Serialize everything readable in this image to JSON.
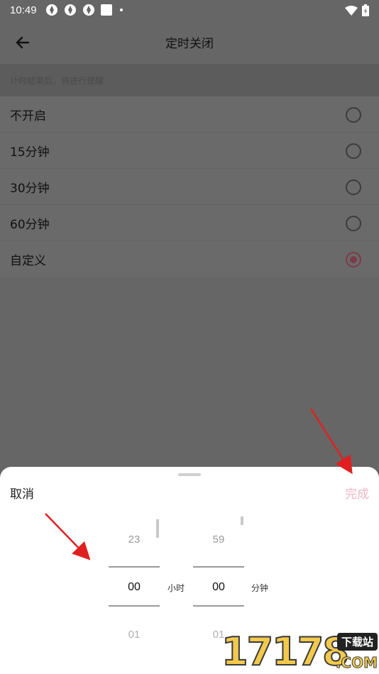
{
  "status_bar": {
    "time": "10:49"
  },
  "app_bar": {
    "title": "定时关闭"
  },
  "hint": "计时结束后，将进行提醒",
  "options": [
    {
      "label": "不开启",
      "selected": false
    },
    {
      "label": "15分钟",
      "selected": false
    },
    {
      "label": "30分钟",
      "selected": false
    },
    {
      "label": "60分钟",
      "selected": false
    },
    {
      "label": "自定义",
      "selected": true
    }
  ],
  "sheet": {
    "cancel_label": "取消",
    "done_label": "完成",
    "hours": {
      "prev": "23",
      "current": "00",
      "next": "01",
      "unit": "小时"
    },
    "minutes": {
      "prev": "59",
      "current": "00",
      "next": "01",
      "unit": "分钟"
    }
  },
  "colors": {
    "accent": "#7d3b4c",
    "done_disabled": "#f3b6c5",
    "arrow": "#e02020"
  },
  "watermark": {
    "number": "17178",
    "badge": "下载站",
    "suffix": ".COM"
  }
}
